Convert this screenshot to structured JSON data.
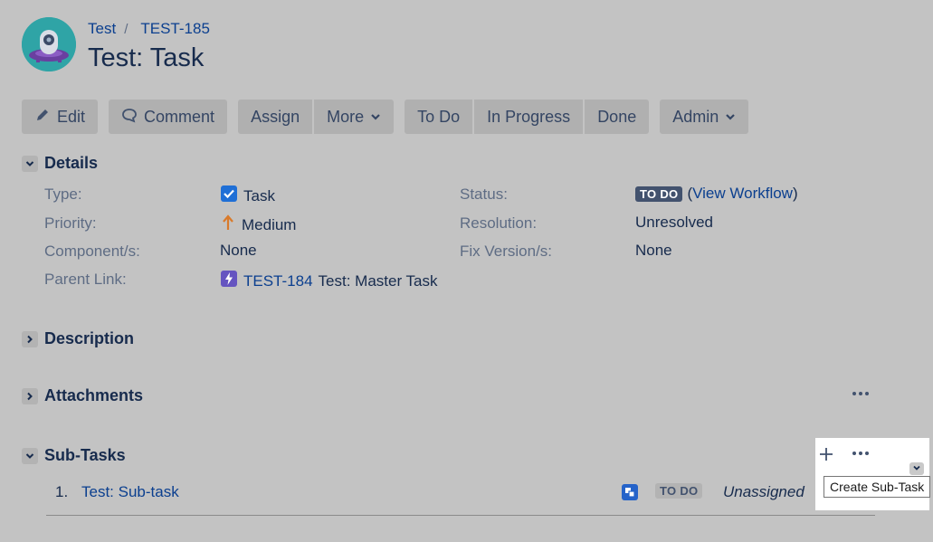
{
  "breadcrumb": {
    "project": "Test",
    "separator": "/",
    "issue_key": "TEST-185"
  },
  "page_title": "Test: Task",
  "toolbar": {
    "edit": "Edit",
    "comment": "Comment",
    "assign": "Assign",
    "more": "More",
    "todo": "To Do",
    "in_progress": "In Progress",
    "done": "Done",
    "admin": "Admin"
  },
  "details": {
    "heading": "Details",
    "type_label": "Type:",
    "type_value": "Task",
    "priority_label": "Priority:",
    "priority_value": "Medium",
    "component_label": "Component/s:",
    "component_value": "None",
    "parent_label": "Parent Link:",
    "parent_key": "TEST-184",
    "parent_summary": "Test: Master Task",
    "status_label": "Status:",
    "status_value": "TO DO",
    "workflow_open": "(",
    "workflow_link": "View Workflow",
    "workflow_close": ")",
    "resolution_label": "Resolution:",
    "resolution_value": "Unresolved",
    "fix_label": "Fix Version/s:",
    "fix_value": "None"
  },
  "sections": {
    "description": "Description",
    "attachments": "Attachments",
    "subtasks": "Sub-Tasks"
  },
  "subtasks": [
    {
      "index": "1.",
      "summary": "Test: Sub-task",
      "status": "TO DO",
      "assignee": "Unassigned"
    }
  ],
  "tooltip": "Create Sub-Task",
  "colors": {
    "background": "#c3c3c3",
    "link": "#0b3f8f",
    "task_icon": "#1f6fd6",
    "priority_medium": "#d97a2b",
    "epic_icon": "#6554c0",
    "subtask_icon": "#2563c9"
  }
}
